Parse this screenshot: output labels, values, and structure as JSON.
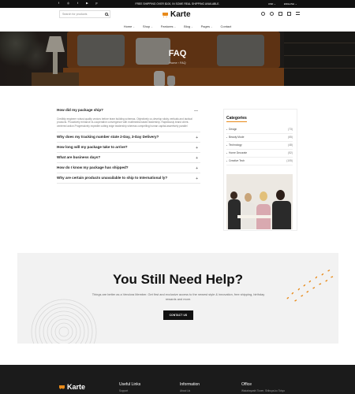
{
  "topbar": {
    "social_icons": [
      "facebook-icon",
      "instagram-icon",
      "twitter-icon",
      "youtube-icon",
      "pinterest-icon"
    ],
    "social_glyphs": [
      "f",
      "◎",
      "t",
      "▶",
      "p"
    ],
    "promo": "FREE SHIPPING OVER $100, IN SOME REAL SHIPPING AVAILABLE.",
    "currency": "USD ⌄",
    "language": "ENGLISH ⌄"
  },
  "header": {
    "search_placeholder": "Search for products",
    "logo": "Karte",
    "icons": [
      "account-icon",
      "wishlist-icon",
      "compare-icon",
      "cart-icon",
      "menu-icon"
    ]
  },
  "nav": {
    "items": [
      {
        "label": "Home",
        "chevron": "⌄"
      },
      {
        "label": "Shop",
        "chevron": "⌄"
      },
      {
        "label": "Features",
        "chevron": "⌄"
      },
      {
        "label": "Blog",
        "chevron": "⌄"
      },
      {
        "label": "Pages",
        "chevron": "⌄"
      },
      {
        "label": "Contact",
        "chevron": ""
      }
    ]
  },
  "hero": {
    "title": "FAQ",
    "breadcrumb_home": "Home",
    "breadcrumb_sep": "›",
    "breadcrumb_current": "FAQ"
  },
  "faq": {
    "items": [
      {
        "question": "How did my package ship?",
        "toggle": "—",
        "open": true,
        "answer": "Credibly engineer robust quality vectors before team building schemas. Objectively co-develop sticky verticals and tactical products. Proactively enhance bi-cooperative convergence with multimedia based leadership. Rapidiously brand client-centered action.Progressively expedite cutting edge leadership whereas compelling human capital.assertively parallel"
      },
      {
        "question": "Why does my tracking number state 2-Day, 3-Day Delivery?",
        "toggle": "+",
        "open": false,
        "answer": ""
      },
      {
        "question": "How long will my package take to arrive?",
        "toggle": "+",
        "open": false,
        "answer": ""
      },
      {
        "question": "What are business days?",
        "toggle": "+",
        "open": false,
        "answer": ""
      },
      {
        "question": "How do I know my package has shipped?",
        "toggle": "+",
        "open": false,
        "answer": ""
      },
      {
        "question": "Why are certain products unavailable to ship to International ly?",
        "toggle": "+",
        "open": false,
        "answer": ""
      }
    ]
  },
  "sidebar": {
    "title": "Categories",
    "categories": [
      {
        "name": "Design",
        "count": "(73)"
      },
      {
        "name": "Beauty Mode",
        "count": "(65)"
      },
      {
        "name": "Technology",
        "count": "(48)"
      },
      {
        "name": "Home Decorate",
        "count": "(52)"
      },
      {
        "name": "Creative Tech",
        "count": "(105)"
      }
    ]
  },
  "help": {
    "title": "You Still Need Help?",
    "text": "Things are better as a Vendora Member. Get first and exclusive access to the newest style & innovation, free shipping, birthday rewards and more.",
    "button": "CONTACT US"
  },
  "footer": {
    "logo": "Karte",
    "columns": [
      {
        "title": "Useful Links",
        "first": "Support"
      },
      {
        "title": "Information",
        "first": "About Us"
      },
      {
        "title": "Office",
        "first": "Wakabayashi Tower, Shibuya-ku Tokyo"
      }
    ]
  },
  "colors": {
    "accent": "#e88a1a",
    "dark": "#111111",
    "footer": "#1b1b1b",
    "banner": "#f2f2f2"
  }
}
